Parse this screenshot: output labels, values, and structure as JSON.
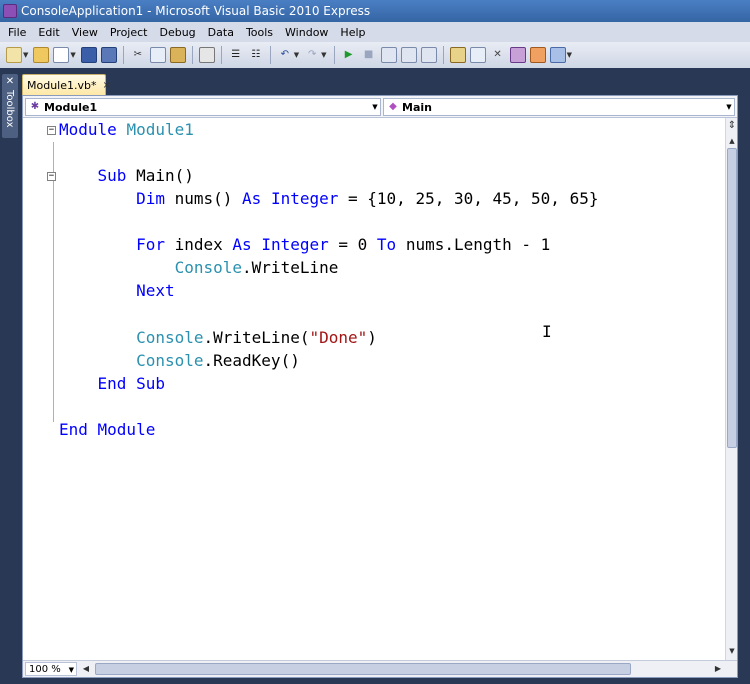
{
  "window": {
    "title": "ConsoleApplication1 - Microsoft Visual Basic 2010 Express"
  },
  "menu": [
    "File",
    "Edit",
    "View",
    "Project",
    "Debug",
    "Data",
    "Tools",
    "Window",
    "Help"
  ],
  "toolbox": {
    "label": "Toolbox"
  },
  "tab": {
    "label": "Module1.vb*",
    "close": "×"
  },
  "nav": {
    "left": "Module1",
    "right": "Main"
  },
  "code": {
    "l1": {
      "kw": "Module",
      "name": "Module1"
    },
    "l2": {
      "kw": "Sub",
      "rest": " Main()"
    },
    "l3": {
      "kw": "Dim",
      "mid": " nums() ",
      "as": "As",
      "ty": "Integer",
      "rest": " = {10, 25, 30, 45, 50, 65}"
    },
    "l4": {
      "kw": "For",
      "mid": " index ",
      "as": "As",
      "ty": "Integer",
      "mid2": " = 0 ",
      "to": "To",
      "rest": " nums.Length - 1"
    },
    "l5": {
      "ty": "Console",
      "rest": ".WriteLine"
    },
    "l6": {
      "kw": "Next"
    },
    "l7": {
      "ty": "Console",
      "mid": ".WriteLine(",
      "st": "\"Done\"",
      "rest": ")"
    },
    "l8": {
      "ty": "Console",
      "rest": ".ReadKey()"
    },
    "l9": {
      "kw": "End Sub"
    },
    "l10": {
      "kw": "End Module"
    }
  },
  "status": {
    "zoom": "100 %"
  },
  "colors": {
    "keyword": "#0000ff",
    "type": "#2b91af",
    "string": "#a31515"
  }
}
